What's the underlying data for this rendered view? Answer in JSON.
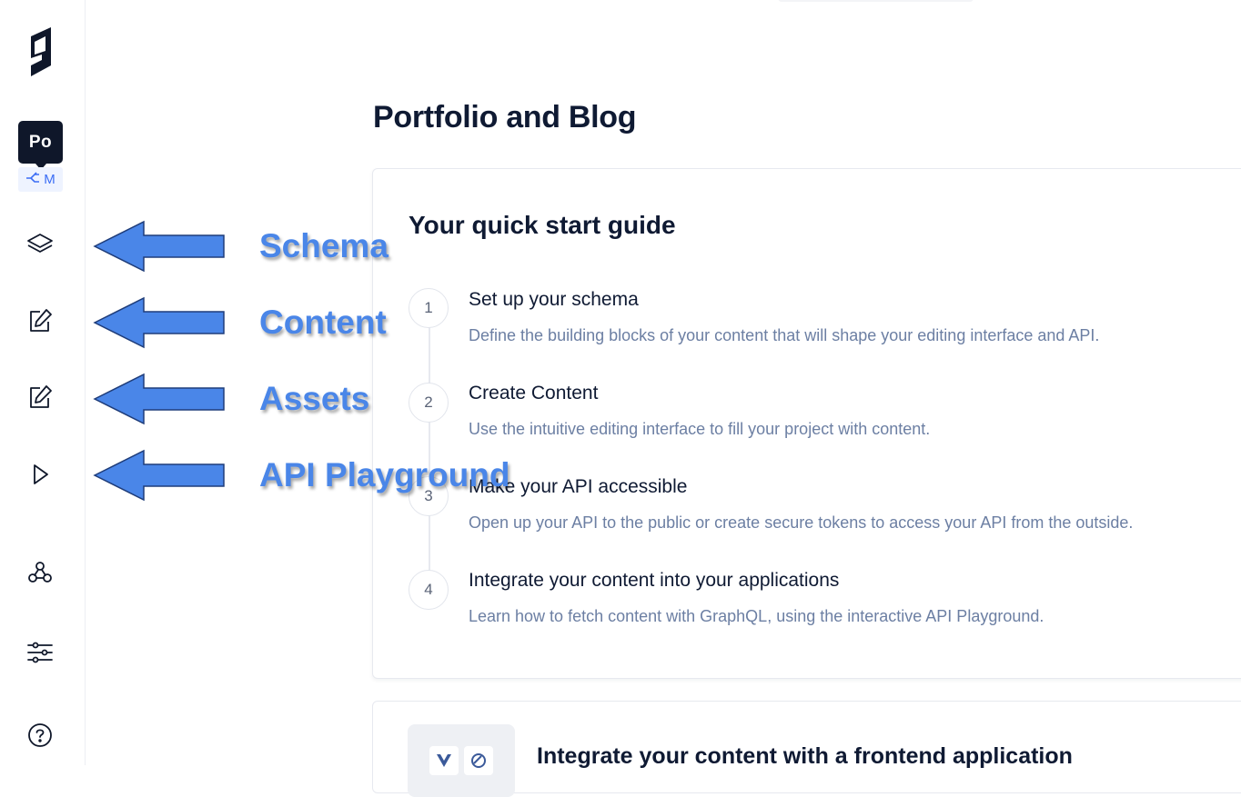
{
  "sidebar": {
    "project_badge": "Po",
    "environment": "M",
    "icons": [
      "logo-icon",
      "layers-icon",
      "edit-icon",
      "edit-icon",
      "play-icon",
      "webhook-icon",
      "sliders-icon",
      "help-icon"
    ]
  },
  "page": {
    "title": "Portfolio and Blog"
  },
  "guide": {
    "title": "Your quick start guide",
    "steps": [
      {
        "number": "1",
        "title": "Set up your schema",
        "desc": "Define the building blocks of your content that will shape your editing interface and API."
      },
      {
        "number": "2",
        "title": "Create Content",
        "desc": "Use the intuitive editing interface to fill your project with content."
      },
      {
        "number": "3",
        "title": "Make your API accessible",
        "desc": "Open up your API to the public or create secure tokens to access your API from the outside."
      },
      {
        "number": "4",
        "title": "Integrate your content into your applications",
        "desc": "Learn how to fetch content with GraphQL, using the interactive API Playground."
      }
    ]
  },
  "integrate": {
    "title": "Integrate your content with a frontend application"
  },
  "annotations": {
    "schema": "Schema",
    "content": "Content",
    "assets": "Assets",
    "api_playground": "API Playground"
  },
  "colors": {
    "annotation": "#4a86e8",
    "arrow_fill": "#4a86e8",
    "badge": "#0f172a",
    "env_tag_text": "#3b6df5"
  }
}
